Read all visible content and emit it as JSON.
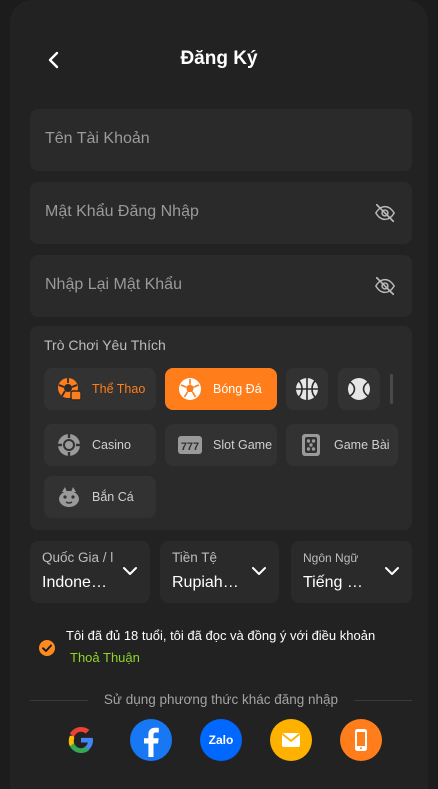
{
  "header": {
    "title": "Đăng Ký"
  },
  "form": {
    "username_placeholder": "Tên Tài Khoản",
    "password_placeholder": "Mật Khẩu Đăng Nhập",
    "confirm_placeholder": "Nhập Lại Mật Khẩu"
  },
  "games": {
    "label": "Trò Chơi Yêu Thích",
    "chips": [
      {
        "label": "Thể Thao",
        "icon": "sports-icon"
      },
      {
        "label": "Bóng Đá",
        "icon": "soccer-ball-icon",
        "selected": true
      },
      {
        "label": "",
        "icon": "basketball-icon"
      },
      {
        "label": "",
        "icon": "tennis-ball-icon"
      },
      {
        "label": "Casino",
        "icon": "casino-chip-icon"
      },
      {
        "label": "Slot Game",
        "icon": "slot-777-icon"
      },
      {
        "label": "Game Bài",
        "icon": "mahjong-tile-icon"
      },
      {
        "label": "Bắn Cá",
        "icon": "fish-icon"
      }
    ]
  },
  "selects": {
    "country": {
      "label": "Quốc Gia / l",
      "value": "Indone…"
    },
    "currency": {
      "label": "Tiền Tệ",
      "value": "Rupiah…"
    },
    "language": {
      "label": "Ngôn Ngữ",
      "value": "Tiếng …"
    }
  },
  "terms": {
    "text": "Tôi đã đủ 18 tuổi, tôi đã đọc và đồng ý với điều khoản",
    "link": "Thoả Thuận",
    "checked": true
  },
  "social": {
    "label": "Sử dụng phương thức khác đăng nhập",
    "providers": [
      "google-icon",
      "facebook-icon",
      "zalo-icon",
      "email-icon",
      "phone-icon"
    ]
  },
  "colors": {
    "accent": "#ff7d1a",
    "link": "#8fd62a",
    "background": "#222222"
  }
}
